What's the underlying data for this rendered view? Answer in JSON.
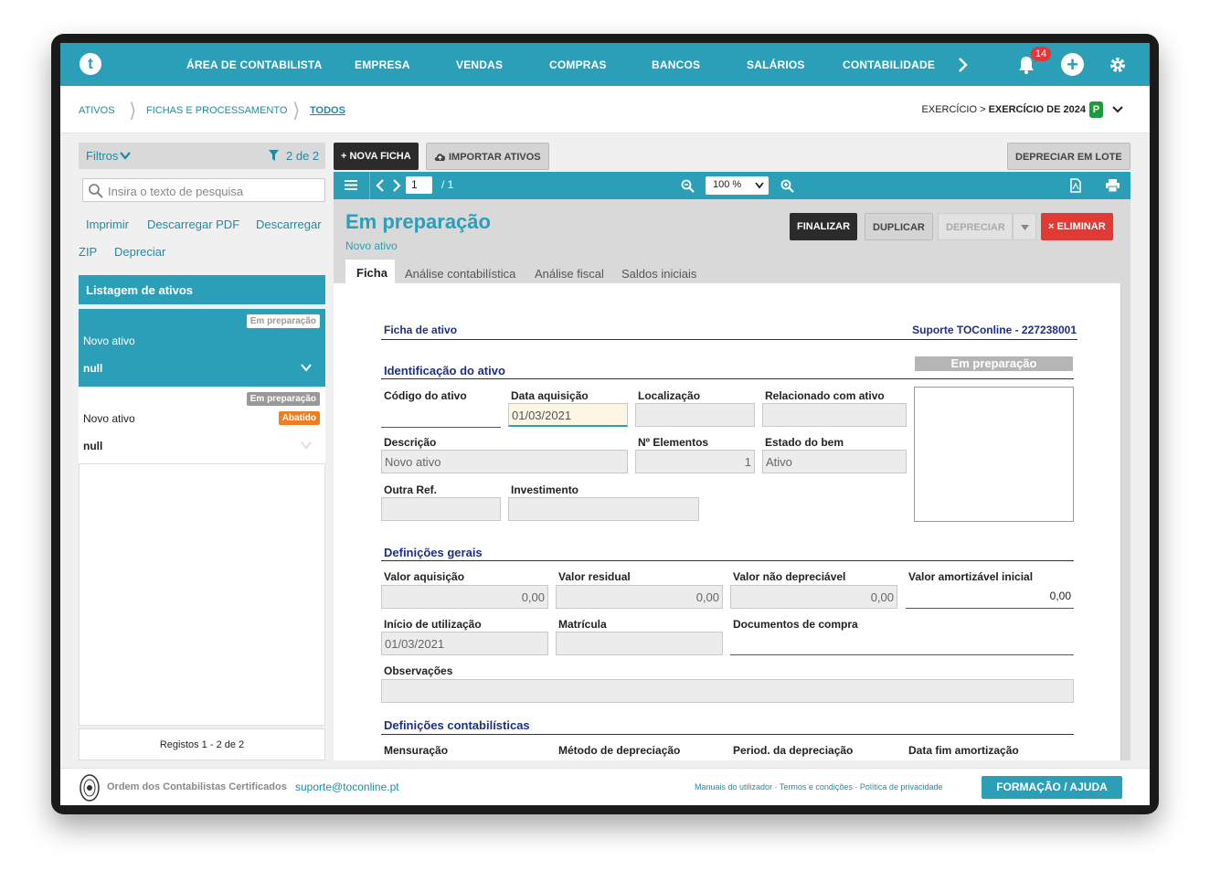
{
  "nav": {
    "items": [
      "ÁREA DE CONTABILISTA",
      "EMPRESA",
      "VENDAS",
      "COMPRAS",
      "BANCOS",
      "SALÁRIOS",
      "CONTABILIDADE"
    ],
    "notifications": "14",
    "logo_letter": "t"
  },
  "breadcrumb": {
    "items": [
      "ATIVOS",
      "FICHAS E PROCESSAMENTO",
      "TODOS"
    ],
    "exercise_prefix": "EXERCÍCIO > ",
    "exercise_value": "EXERCÍCIO DE 2024",
    "exercise_badge": "P"
  },
  "sidebar": {
    "filters_label": "Filtros",
    "filter_count": "2 de 2",
    "search_placeholder": "Insira o texto de pesquisa",
    "links": [
      "Imprimir",
      "Descarregar PDF",
      "Descarregar",
      "ZIP",
      "Depreciar"
    ],
    "list_title": "Listagem de ativos",
    "items": [
      {
        "badge": "Em preparação",
        "name": "Novo ativo",
        "code": "null"
      },
      {
        "badge": "Em preparação",
        "badge2": "Abatido",
        "name": "Novo ativo",
        "code": "null"
      }
    ],
    "records": "Registos 1 - 2 de 2"
  },
  "toolbar": {
    "new_label": "+ NOVA FICHA",
    "import_label": "IMPORTAR ATIVOS",
    "batch_label": "DEPRECIAR EM LOTE",
    "page_current": "1",
    "page_total": "/ 1",
    "zoom": "100 %"
  },
  "doc": {
    "title": "Em preparação",
    "subtitle": "Novo ativo",
    "actions": [
      "FINALIZAR",
      "DUPLICAR",
      "DEPRECIAR",
      "× ELIMINAR"
    ],
    "tabs": [
      "Ficha",
      "Análise contabilística",
      "Análise fiscal",
      "Saldos iniciais"
    ]
  },
  "form": {
    "header_left": "Ficha de ativo",
    "header_right": "Suporte TOConline - 227238001",
    "status_box": "Em preparação",
    "sections": [
      "Identificação do ativo",
      "Definições gerais",
      "Definições contabilísticas"
    ],
    "labels": {
      "codigo": "Código do ativo",
      "data_aq": "Data aquisição",
      "localizacao": "Localização",
      "relacionado": "Relacionado com ativo",
      "descricao": "Descrição",
      "n_elementos": "Nº Elementos",
      "estado": "Estado do bem",
      "outra_ref": "Outra Ref.",
      "investimento": "Investimento",
      "valor_aq": "Valor aquisição",
      "valor_res": "Valor residual",
      "valor_nd": "Valor não depreciável",
      "valor_am": "Valor amortizável inicial",
      "inicio": "Início de utilização",
      "matricula": "Matrícula",
      "documentos": "Documentos de compra",
      "observacoes": "Observações",
      "mensuracao": "Mensuração",
      "metodo": "Método de depreciação",
      "period": "Period. da depreciação",
      "data_fim": "Data fim amortização"
    },
    "values": {
      "data_aq": "01/03/2021",
      "descricao": "Novo ativo",
      "n_elementos": "1",
      "estado": "Ativo",
      "valor_aq": "0,00",
      "valor_res": "0,00",
      "valor_nd": "0,00",
      "valor_am": "0,00",
      "inicio": "01/03/2021"
    }
  },
  "footer": {
    "org": "Ordem dos Contabilistas Certificados",
    "email": "suporte@toconline.pt",
    "links": "Manuais do utilizador · Termos e condições · Política de privacidade",
    "help_button": "FORMAÇÃO / AJUDA"
  }
}
